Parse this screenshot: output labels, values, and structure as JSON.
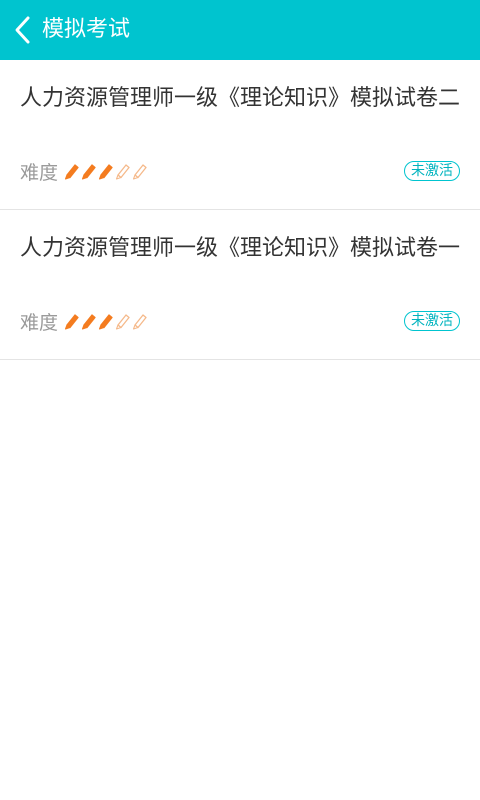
{
  "header": {
    "title": "模拟考试",
    "back_icon": "chevron-left-icon",
    "background_color": "#00c4cf"
  },
  "exams": [
    {
      "title": "人力资源管理师一级《理论知识》模拟试卷二",
      "difficulty_label": "难度",
      "difficulty": 3,
      "difficulty_max": 5,
      "status": "未激活"
    },
    {
      "title": "人力资源管理师一级《理论知识》模拟试卷一",
      "difficulty_label": "难度",
      "difficulty": 3,
      "difficulty_max": 5,
      "status": "未激活"
    }
  ],
  "colors": {
    "accent": "#00c4cf",
    "pencil_filled": "#f47c20",
    "pencil_empty": "#f5b98a"
  }
}
